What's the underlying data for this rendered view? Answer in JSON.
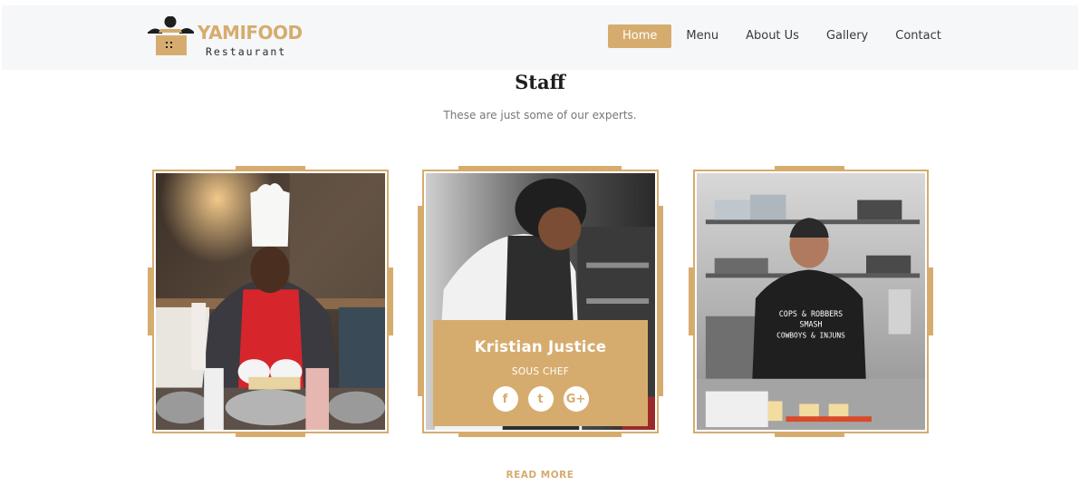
{
  "header": {
    "brand_name": "YAMIFOOD",
    "brand_subtitle": "Restaurant",
    "nav": [
      {
        "label": "Home",
        "active": true
      },
      {
        "label": "Menu",
        "active": false
      },
      {
        "label": "About Us",
        "active": false
      },
      {
        "label": "Gallery",
        "active": false
      },
      {
        "label": "Contact",
        "active": false
      }
    ]
  },
  "staff": {
    "title": "Staff",
    "subtitle": "These are just some of our experts.",
    "featured": {
      "name": "Kristian Justice",
      "role": "SOUS CHEF",
      "social_icons": [
        "facebook-icon",
        "twitter-icon",
        "google-plus-icon"
      ],
      "social_glyphs": [
        "f",
        "t",
        "G+"
      ]
    },
    "shirt_text": [
      "COPS & ROBBERS",
      "SMASH",
      "COWBOYS & INJUNS"
    ],
    "read_more": "READ MORE"
  },
  "colors": {
    "accent": "#d6ac6e",
    "header_bg": "#f6f7f9",
    "text_dark": "#1e1e1e",
    "text_muted": "#777777"
  }
}
